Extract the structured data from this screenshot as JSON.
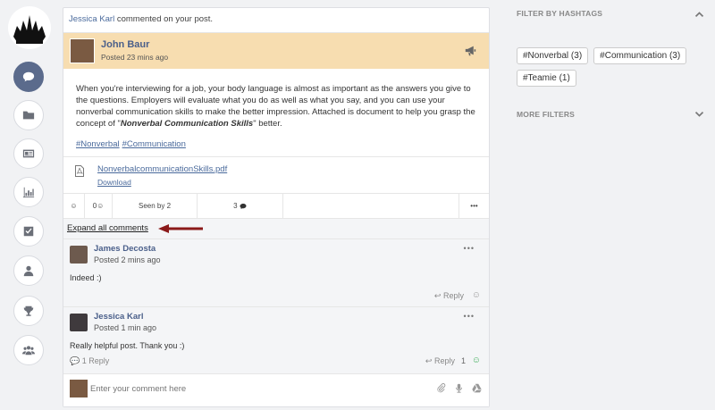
{
  "notification": {
    "actor": "Jessica Karl",
    "text": " commented on your post."
  },
  "post": {
    "author": "John Baur",
    "time": "Posted 23 mins ago",
    "body_1": "When you're interviewing for a job, your body language is almost as important as the answers you give to the questions. Employers will evaluate what you do as well as what you say, and you can use your nonverbal communication skills to make the better impression. Attached is document to help you grasp the concept of \"",
    "body_quote": "Nonverbal Communication Skills",
    "body_2": "\" better.",
    "hashtags": [
      "#Nonverbal",
      "#Communication"
    ],
    "attachment": {
      "name": "NonverbalcommunicationSkills.pdf",
      "action": "Download"
    },
    "actions": {
      "smile_count": "0",
      "seen": "Seen by 2",
      "comments": "3",
      "more": "•••"
    }
  },
  "expand_label": "Expand all comments",
  "comments": [
    {
      "name": "James Decosta",
      "time": "Posted 2 mins ago",
      "text": "Indeed :)",
      "reply": "Reply",
      "menu": "•••"
    },
    {
      "name": "Jessica Karl",
      "time": "Posted 1 min ago",
      "text": "Really helpful post. Thank you :)",
      "reply": "Reply",
      "replies": "1 Reply",
      "count": "1",
      "menu": "•••"
    }
  ],
  "compose": {
    "placeholder": "Enter your comment here"
  },
  "sidebar": {
    "filter_title": "FILTER BY HASHTAGS",
    "tags": [
      "#Nonverbal (3)",
      "#Communication (3)",
      "#Teamie (1)"
    ],
    "more_title": "MORE FILTERS"
  },
  "rail_icons": [
    "chat-icon",
    "folder-icon",
    "news-icon",
    "chart-icon",
    "check-icon",
    "user-icon",
    "trophy-icon",
    "group-icon"
  ],
  "colors": {
    "accent": "#5b6b8c",
    "link": "#4a6a9c",
    "post_header": "#f7ddb0",
    "arrow": "#8b1a1a"
  }
}
